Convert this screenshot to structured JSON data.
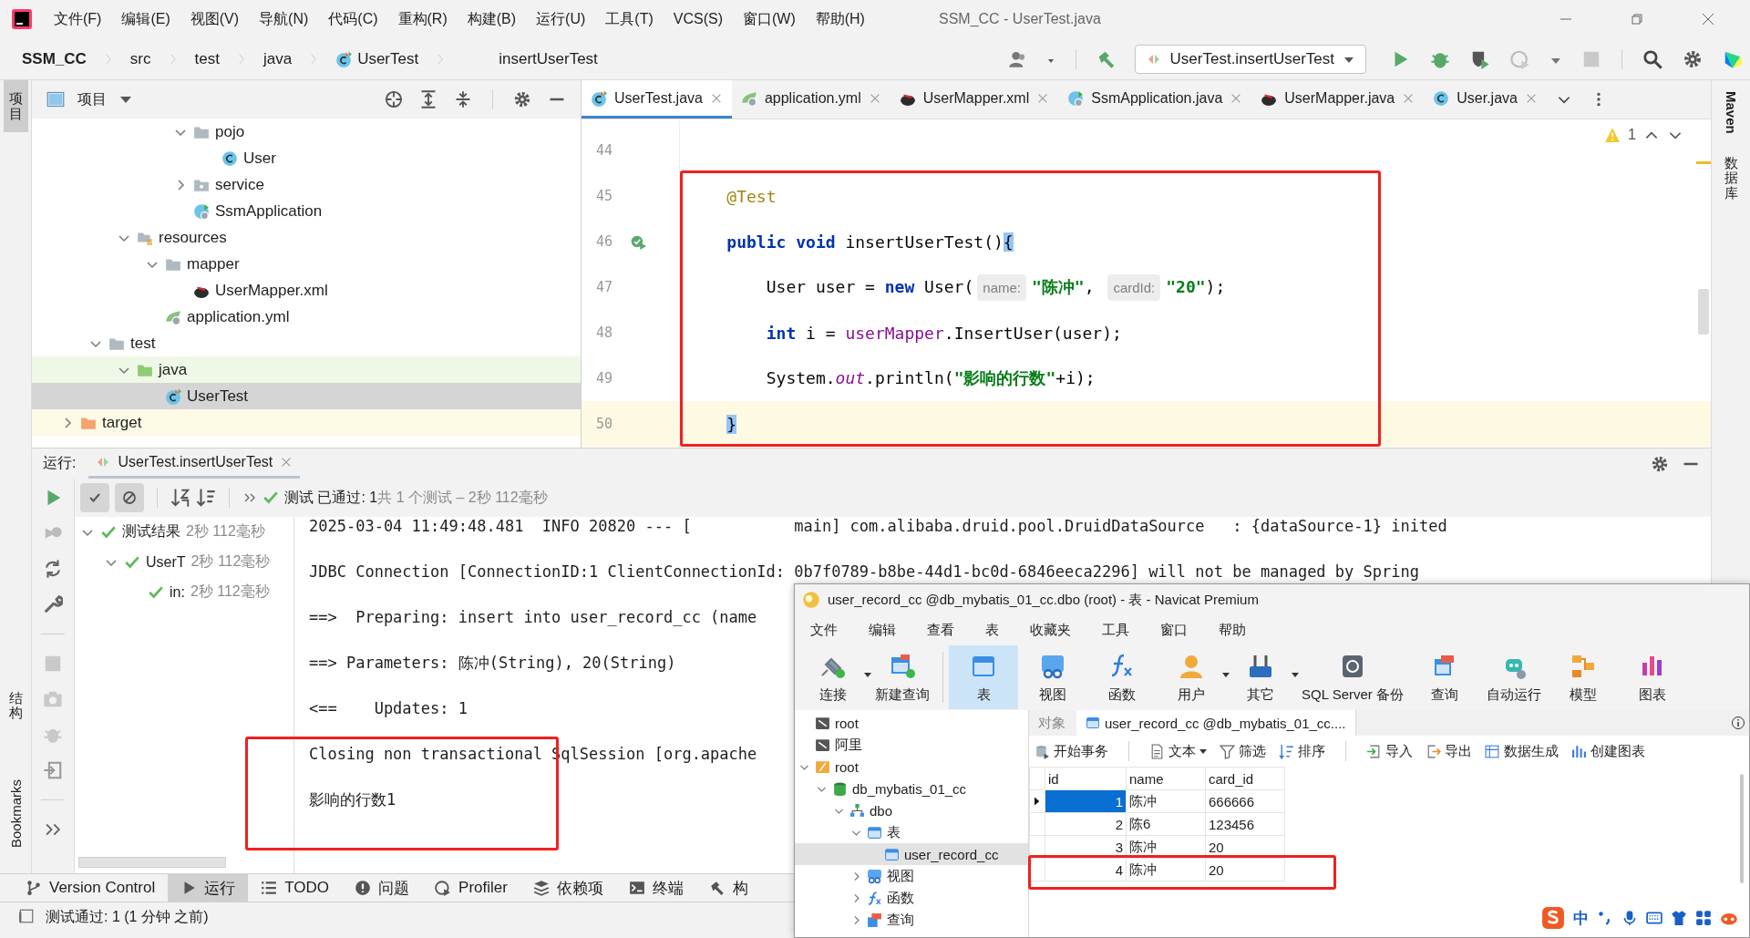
{
  "menu_bar": {
    "items": [
      "文件(F)",
      "编辑(E)",
      "视图(V)",
      "导航(N)",
      "代码(C)",
      "重构(R)",
      "构建(B)",
      "运行(U)",
      "工具(T)",
      "VCS(S)",
      "窗口(W)",
      "帮助(H)"
    ],
    "title": "SSM_CC - UserTest.java"
  },
  "navigation_bar": {
    "breadcrumbs": [
      {
        "label": "SSM_CC",
        "kind": "project"
      },
      {
        "label": "src",
        "kind": "plain"
      },
      {
        "label": "test",
        "kind": "plain"
      },
      {
        "label": "java",
        "kind": "plain"
      },
      {
        "label": "UserTest",
        "kind": "test-class"
      }
    ],
    "member": "insertUserTest",
    "run_config": "UserTest.insertUserTest"
  },
  "side_strips": {
    "left": [
      {
        "label": "项目",
        "kind": "cjk",
        "selected": true
      },
      {
        "label": "结构",
        "kind": "cjk",
        "selected": false
      },
      {
        "label": "Bookmarks",
        "kind": "latin",
        "selected": false
      }
    ],
    "right": [
      {
        "label": "Maven",
        "kind": "latin",
        "selected": false
      },
      {
        "label": "数据库",
        "kind": "cjk",
        "selected": false
      }
    ]
  },
  "project_panel": {
    "title": "项目",
    "tree": [
      {
        "children": [
          {
            "children": [
              {
                "children": [
                  {
                    "children": [
                      {
                        "label": "pojo",
                        "kind": "folder",
                        "expanded": true,
                        "selected": false,
                        "children": [
                          {
                            "label": "User",
                            "kind": "class",
                            "selected": false
                          }
                        ]
                      },
                      {
                        "label": "service",
                        "kind": "package",
                        "expanded": false,
                        "selected": false
                      },
                      {
                        "label": "SsmApplication",
                        "kind": "spring-class",
                        "selected": false
                      }
                    ]
                  }
                ]
              },
              {
                "label": "resources",
                "kind": "resources-folder",
                "expanded": true,
                "selected": false,
                "children": [
                  {
                    "label": "mapper",
                    "kind": "folder",
                    "expanded": true,
                    "selected": false,
                    "children": [
                      {
                        "label": "UserMapper.xml",
                        "kind": "mybatis",
                        "selected": false
                      }
                    ]
                  },
                  {
                    "label": "application.yml",
                    "kind": "spring-config",
                    "selected": false
                  }
                ]
              }
            ]
          },
          {
            "label": "test",
            "kind": "folder",
            "expanded": true,
            "selected": false,
            "children": [
              {
                "label": "java",
                "kind": "test-folder",
                "expanded": true,
                "selected": false,
                "children": [
                  {
                    "label": "UserTest",
                    "kind": "test-class",
                    "selected": true
                  }
                ]
              }
            ]
          }
        ]
      },
      {
        "label": "target",
        "kind": "excluded-folder",
        "expanded": false,
        "selected": false
      }
    ]
  },
  "editor": {
    "tabs": [
      {
        "label": "UserTest.java",
        "kind": "test-class",
        "selected": true
      },
      {
        "label": "application.yml",
        "kind": "spring-config",
        "selected": false
      },
      {
        "label": "UserMapper.xml",
        "kind": "mybatis",
        "selected": false
      },
      {
        "label": "SsmApplication.java",
        "kind": "spring-class",
        "selected": false
      },
      {
        "label": "UserMapper.java",
        "kind": "mybatis",
        "selected": false
      },
      {
        "label": "User.java",
        "kind": "class",
        "selected": false
      }
    ],
    "warnings": "1",
    "lines": [
      {
        "number": "44",
        "current": false,
        "run_marker": false
      },
      {
        "number": "45",
        "current": false,
        "run_marker": false,
        "tokens": [
          {
            "kind": "annotation",
            "text": "    @Test"
          }
        ]
      },
      {
        "number": "46",
        "current": false,
        "run_marker": true,
        "tokens": [
          {
            "kind": "keyword",
            "text": "    public "
          },
          {
            "kind": "keyword",
            "text": "void"
          },
          {
            "kind": "plain",
            "text": " insertUserTest()"
          },
          {
            "kind": "brace",
            "text": "{"
          }
        ]
      },
      {
        "number": "47",
        "current": false,
        "run_marker": false,
        "tokens": [
          {
            "kind": "plain",
            "text": "        User user = "
          },
          {
            "kind": "keyword",
            "text": "new"
          },
          {
            "kind": "plain",
            "text": " User("
          },
          {
            "kind": "hint",
            "text": "name:"
          },
          {
            "kind": "string",
            "text": "\"陈冲\""
          },
          {
            "kind": "plain",
            "text": ", "
          },
          {
            "kind": "hint",
            "text": "cardId:"
          },
          {
            "kind": "string",
            "text": "\"20\""
          },
          {
            "kind": "plain",
            "text": ");"
          }
        ]
      },
      {
        "number": "48",
        "current": false,
        "run_marker": false,
        "tokens": [
          {
            "kind": "keyword",
            "text": "        int"
          },
          {
            "kind": "plain",
            "text": " i = "
          },
          {
            "kind": "field",
            "text": "userMapper"
          },
          {
            "kind": "plain",
            "text": ".InsertUser(user);"
          }
        ]
      },
      {
        "number": "49",
        "current": false,
        "run_marker": false,
        "tokens": [
          {
            "kind": "plain",
            "text": "        System."
          },
          {
            "kind": "static",
            "text": "out"
          },
          {
            "kind": "plain",
            "text": ".println("
          },
          {
            "kind": "string",
            "text": "\"影响的行数\""
          },
          {
            "kind": "plain",
            "text": "+i);"
          }
        ]
      },
      {
        "number": "50",
        "current": true,
        "run_marker": false,
        "tokens": [
          {
            "kind": "brace",
            "text": "    }"
          }
        ]
      }
    ]
  },
  "run_panel": {
    "label": "运行:",
    "tab": "UserTest.insertUserTest",
    "status": {
      "passed": "测试 已通过: 1",
      "summary": "共 1 个测试 – 2秒 112毫秒"
    },
    "tests": [
      {
        "label": "测试结果",
        "time": "2秒 112毫秒",
        "expanded": true,
        "selected": false,
        "children": [
          {
            "label": "UserT",
            "time": "2秒 112毫秒",
            "expanded": true,
            "selected": false,
            "children": [
              {
                "label": "in:",
                "time": "2秒 112毫秒",
                "selected": false
              }
            ]
          }
        ]
      }
    ],
    "console": [
      "2025-03-04 11:49:48.481  INFO 20820 --- [           main] com.alibaba.druid.pool.DruidDataSource   : {dataSource-1} inited",
      "JDBC Connection [ConnectionID:1 ClientConnectionId: 0b7f0789-b8be-44d1-bc0d-6846eeca2296] will not be managed by Spring",
      "==>  Preparing: insert into user_record_cc (name",
      "==> Parameters: 陈冲(String), 20(String)",
      "<==    Updates: 1",
      "Closing non transactional SqlSession [org.apache",
      "影响的行数1"
    ]
  },
  "tool_window_bar": [
    {
      "label": "Version Control",
      "kind": "vcs",
      "selected": false
    },
    {
      "label": "运行",
      "kind": "run",
      "selected": true
    },
    {
      "label": "TODO",
      "kind": "todo",
      "selected": false
    },
    {
      "label": "问题",
      "kind": "problems",
      "selected": false
    },
    {
      "label": "Profiler",
      "kind": "profiler",
      "selected": false
    },
    {
      "label": "依赖项",
      "kind": "deps",
      "selected": false
    },
    {
      "label": "终端",
      "kind": "terminal",
      "selected": false
    },
    {
      "label": "构",
      "kind": "build",
      "selected": false
    }
  ],
  "status_bar": "测试通过: 1 (1 分钟 之前)",
  "navicat": {
    "title": "user_record_cc @db_mybatis_01_cc.dbo (root) - 表 - Navicat Premium",
    "menu": [
      "文件",
      "编辑",
      "查看",
      "表",
      "收藏夹",
      "工具",
      "窗口",
      "帮助"
    ],
    "toolbar": [
      {
        "label": "连接",
        "kind": "connect",
        "selected": false,
        "has_menu": true
      },
      {
        "label": "新建查询",
        "kind": "new-query",
        "selected": false,
        "has_menu": false
      },
      {
        "label": "表",
        "kind": "table",
        "selected": true,
        "has_menu": false
      },
      {
        "label": "视图",
        "kind": "view",
        "selected": false,
        "has_menu": false
      },
      {
        "label": "函数",
        "kind": "function",
        "selected": false,
        "has_menu": false
      },
      {
        "label": "用户",
        "kind": "user",
        "selected": false,
        "has_menu": true
      },
      {
        "label": "其它",
        "kind": "other",
        "selected": false,
        "has_menu": true
      },
      {
        "label": "SQL Server 备份",
        "kind": "backup",
        "selected": false,
        "has_menu": false
      },
      {
        "label": "查询",
        "kind": "query",
        "selected": false,
        "has_menu": false
      },
      {
        "label": "自动运行",
        "kind": "robot",
        "selected": false,
        "has_menu": false
      },
      {
        "label": "模型",
        "kind": "model",
        "selected": false,
        "has_menu": false
      },
      {
        "label": "图表",
        "kind": "chart",
        "selected": false,
        "has_menu": false
      }
    ],
    "tree": [
      {
        "label": "root",
        "kind": "connection",
        "selected": false
      },
      {
        "label": "阿里",
        "kind": "connection",
        "selected": false
      },
      {
        "label": "root",
        "kind": "server",
        "expanded": true,
        "selected": false,
        "children": [
          {
            "label": "db_mybatis_01_cc",
            "kind": "database",
            "expanded": true,
            "selected": false,
            "children": [
              {
                "label": "dbo",
                "kind": "schema",
                "expanded": true,
                "selected": false,
                "children": [
                  {
                    "label": "表",
                    "kind": "tables",
                    "expanded": true,
                    "selected": false,
                    "children": [
                      {
                        "label": "user_record_cc",
                        "kind": "table",
                        "selected": true
                      }
                    ]
                  },
                  {
                    "label": "视图",
                    "kind": "views",
                    "expanded": false,
                    "selected": false
                  },
                  {
                    "label": "函数",
                    "kind": "functions",
                    "expanded": false,
                    "selected": false
                  },
                  {
                    "label": "查询",
                    "kind": "queries",
                    "expanded": false,
                    "selected": false
                  }
                ]
              }
            ]
          }
        ]
      }
    ],
    "tabs": [
      {
        "label": "对象",
        "kind": "objects",
        "selected": false
      },
      {
        "label": "user_record_cc @db_mybatis_01_cc....",
        "kind": "table",
        "selected": true
      }
    ],
    "actions": [
      {
        "label": "开始事务",
        "kind": "transaction",
        "has_menu": false
      },
      {
        "label": "文本",
        "kind": "text",
        "has_menu": true
      },
      {
        "label": "筛选",
        "kind": "filter",
        "has_menu": false
      },
      {
        "label": "排序",
        "kind": "sort",
        "has_menu": false
      },
      {
        "label": "导入",
        "kind": "import",
        "has_menu": false
      },
      {
        "label": "导出",
        "kind": "export",
        "has_menu": false
      },
      {
        "label": "数据生成",
        "kind": "generate",
        "has_menu": false
      },
      {
        "label": "创建图表",
        "kind": "chart",
        "has_menu": false
      }
    ],
    "grid": {
      "columns": [
        "id",
        "name",
        "card_id"
      ],
      "rows": [
        {
          "cells": [
            "1",
            "陈冲",
            "666666"
          ],
          "selected": true
        },
        {
          "cells": [
            "2",
            "陈6",
            "123456"
          ],
          "selected": false
        },
        {
          "cells": [
            "3",
            "陈冲",
            "20"
          ],
          "selected": false
        },
        {
          "cells": [
            "4",
            "陈冲",
            "20"
          ],
          "selected": false
        }
      ]
    },
    "ime_bar": {
      "label": "中"
    }
  },
  "annotations": [
    {
      "kind": "editor-code"
    },
    {
      "kind": "console-output"
    },
    {
      "kind": "table-row"
    }
  ]
}
